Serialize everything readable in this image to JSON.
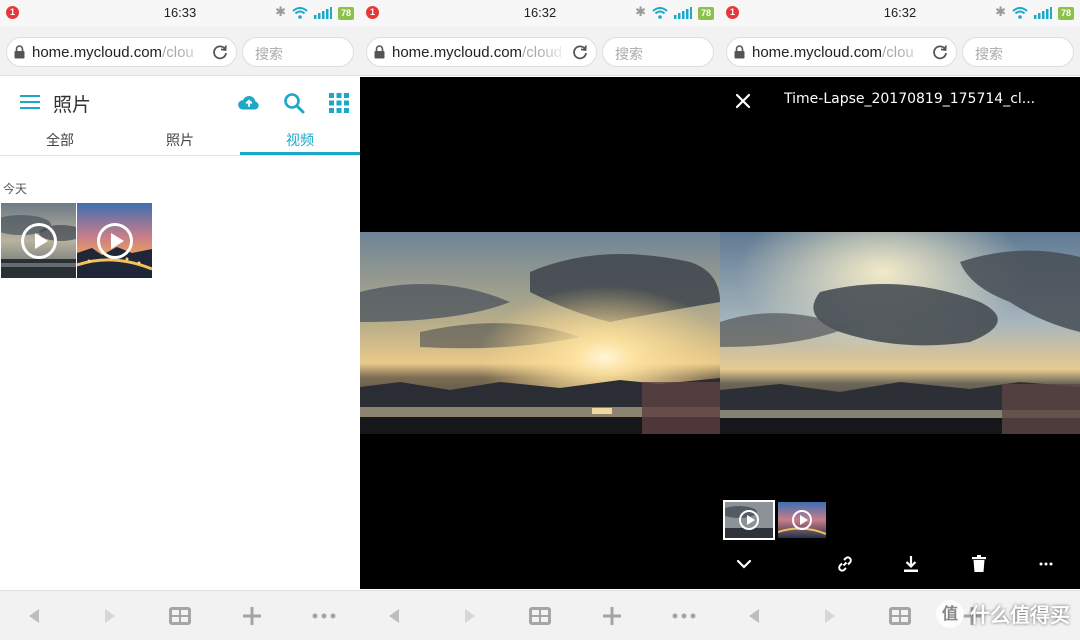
{
  "panels": [
    {
      "status": {
        "notif": "1",
        "time": "16:33",
        "battery": "78"
      },
      "browser": {
        "url_main": "home.mycloud.com",
        "url_rest": "/clou",
        "search_placeholder": "搜索"
      },
      "app": {
        "title": "照片",
        "tabs": [
          {
            "label": "全部"
          },
          {
            "label": "照片"
          },
          {
            "label": "视频"
          }
        ],
        "active_tab": "视频",
        "section_label": "今天"
      }
    },
    {
      "status": {
        "notif": "1",
        "time": "16:32",
        "battery": "78"
      },
      "browser": {
        "url_main": "home.mycloud.com",
        "url_rest": "/cloud",
        "search_placeholder": "搜索"
      }
    },
    {
      "status": {
        "notif": "1",
        "time": "16:32",
        "battery": "78"
      },
      "browser": {
        "url_main": "home.mycloud.com",
        "url_rest": "/clou",
        "search_placeholder": "搜索"
      },
      "viewer": {
        "title": "Time-Lapse_20170819_175714_cl..."
      }
    }
  ],
  "watermark": {
    "badge": "值",
    "text": "什么值得买"
  },
  "colors": {
    "accent": "#1ea8c8",
    "notif": "#e53935",
    "battery": "#8bc34a"
  },
  "icons": [
    "menu-icon",
    "upload-cloud-icon",
    "search-icon",
    "grid-icon",
    "close-icon",
    "chevron-down-icon",
    "link-icon",
    "download-icon",
    "trash-icon",
    "more-icon",
    "play-icon",
    "back-icon",
    "forward-icon",
    "tabs-icon",
    "plus-icon",
    "menu-dots-icon",
    "lock-icon",
    "reload-icon",
    "bluetooth-icon",
    "wifi-icon",
    "signal-icon"
  ]
}
